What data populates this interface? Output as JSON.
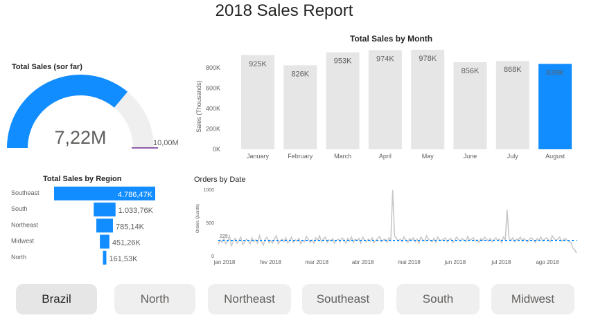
{
  "report_title": "2018 Sales Report",
  "gauge": {
    "title": "Total Sales (sor far)",
    "value_label": "7,22M",
    "target_label": "10,00M",
    "fill_fraction": 0.722,
    "fill_color": "#118DFF",
    "track_color": "#F0EFEF",
    "target_color": "#6B2C91"
  },
  "buttons": [
    {
      "label": "Brazil",
      "active": true
    },
    {
      "label": "North"
    },
    {
      "label": "Northeast"
    },
    {
      "label": "Southeast"
    },
    {
      "label": "South"
    },
    {
      "label": "Midwest"
    }
  ],
  "chart_data": [
    {
      "type": "bar",
      "title": "Total Sales by Month",
      "ylabel": "Sales (Thousands)",
      "xlabel": "",
      "categories": [
        "January",
        "February",
        "March",
        "April",
        "May",
        "June",
        "July",
        "August"
      ],
      "values": [
        925,
        826,
        953,
        974,
        978,
        856,
        868,
        839
      ],
      "data_labels": [
        "925K",
        "826K",
        "953K",
        "974K",
        "978K",
        "856K",
        "868K",
        "839K"
      ],
      "ylim": [
        0,
        978
      ],
      "y_ticks": [
        0,
        200,
        400,
        600,
        800
      ],
      "y_tick_labels": [
        "0K",
        "200K",
        "400K",
        "600K",
        "800K"
      ],
      "highlight_index": 7,
      "colors": {
        "default": "#E6E6E6",
        "highlight": "#118DFF"
      },
      "grid": false
    },
    {
      "type": "bar",
      "orientation": "horizontal",
      "title": "Total Sales by Region",
      "categories": [
        "Southeast",
        "South",
        "Northeast",
        "Midwest",
        "North"
      ],
      "values": [
        4786.47,
        1033.76,
        785.14,
        451.26,
        161.53
      ],
      "data_labels": [
        "4.786,47K",
        "1.033,76K",
        "785,14K",
        "451,26K",
        "161,53K"
      ],
      "color": "#118DFF",
      "grid": false
    },
    {
      "type": "line",
      "title": "Orders by Date",
      "ylabel": "Orders Quantity",
      "x_ticks": [
        "jan 2018",
        "fev 2018",
        "mar 2018",
        "abr 2018",
        "mai 2018",
        "jun 2018",
        "jul 2018",
        "ago 2018"
      ],
      "y_ticks": [
        0,
        500,
        1000
      ],
      "ylim": [
        0,
        1000
      ],
      "average": 229,
      "average_label": "229",
      "line_color": "#C8C8C8",
      "average_color": "#118DFF",
      "series": [
        {
          "values": [
            170,
            240,
            200,
            260,
            180,
            220,
            300,
            150,
            210,
            260,
            190,
            230,
            280,
            170,
            200,
            250,
            220,
            180,
            270,
            210,
            240,
            190,
            300,
            220,
            160,
            250,
            280,
            200,
            230,
            190,
            260,
            300,
            180,
            220,
            250,
            210,
            270,
            190,
            230,
            280,
            200,
            240,
            220,
            260,
            180,
            230,
            210,
            290,
            250,
            200,
            240,
            190,
            270,
            230,
            300,
            210,
            250,
            280,
            200,
            240,
            220,
            260,
            190,
            230,
            250,
            210,
            270,
            240,
            190,
            260,
            220,
            280,
            200,
            250,
            230,
            260,
            190,
            280,
            240,
            210,
            250,
            220,
            270,
            200,
            230,
            260,
            290,
            210,
            240,
            250,
            200,
            270,
            230,
            990,
            300,
            260,
            220,
            250,
            210,
            280,
            240,
            200,
            260,
            230,
            270,
            210,
            250,
            190,
            280,
            240,
            220,
            300,
            250,
            230,
            210,
            260,
            200,
            280,
            240,
            230,
            250,
            270,
            210,
            240,
            260,
            200,
            230,
            280,
            250,
            220,
            260,
            240,
            210,
            290,
            230,
            250,
            270,
            220,
            240,
            200,
            260,
            230,
            280,
            250,
            220,
            260,
            210,
            240,
            270,
            230,
            250,
            200,
            280,
            240,
            690,
            260,
            230,
            270,
            210,
            250,
            240,
            280,
            220,
            260,
            230,
            210,
            250,
            270,
            240,
            200,
            260,
            230,
            280,
            220,
            250,
            270,
            240,
            210,
            300,
            260,
            230,
            250,
            280,
            220,
            240,
            260,
            230,
            210,
            200,
            120,
            90,
            40
          ]
        }
      ]
    }
  ]
}
